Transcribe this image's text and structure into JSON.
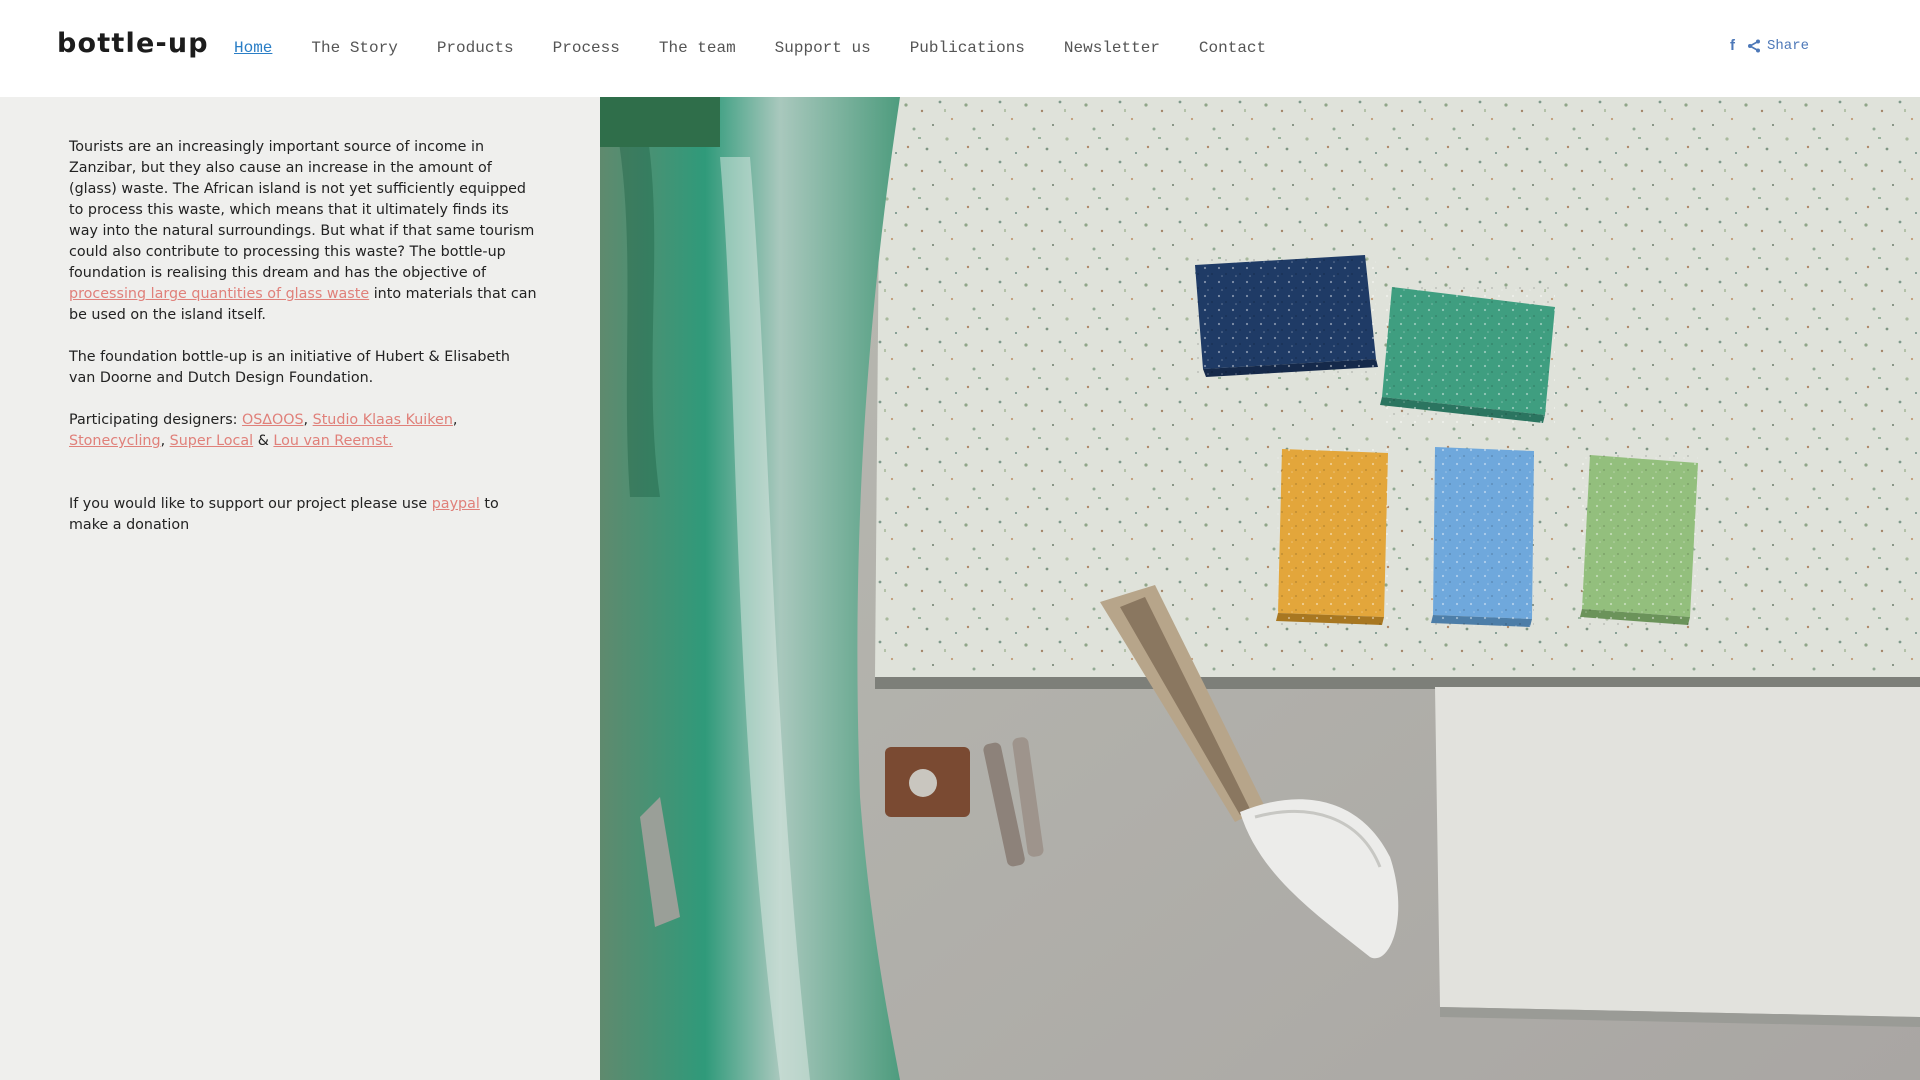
{
  "header": {
    "logo": "bottle-up",
    "nav": [
      {
        "label": "Home",
        "active": true
      },
      {
        "label": "The Story"
      },
      {
        "label": "Products"
      },
      {
        "label": "Process"
      },
      {
        "label": "The team"
      },
      {
        "label": "Support us"
      },
      {
        "label": "Publications"
      },
      {
        "label": "Newsletter"
      },
      {
        "label": "Contact"
      }
    ],
    "social": {
      "facebook_icon": "facebook-icon",
      "share_icon": "share-icon",
      "share_label": "Share"
    }
  },
  "content": {
    "intro_before_link": "Tourists are an increasingly important source of income in Zanzibar, but they also cause an increase in the amount of (glass) waste. The African island is not yet sufficiently equipped to process this waste, which means that it ultimately finds its way into the natural surroundings. But what if that same tourism could also contribute to processing this waste? The bottle-up foundation is realising this dream and has the objective of ",
    "intro_link": "processing large quantities of glass waste",
    "intro_after_link": " into materials that can be used on the island itself.",
    "foundation": "The foundation bottle-up is an initiative of Hubert & Elisabeth van Doorne and Dutch Design Foundation.",
    "designers_prefix": "Participating designers: ",
    "designers": [
      "OS∆OOS",
      "Studio Klaas Kuiken",
      "Stonecycling",
      "Super Local",
      "Lou van Reemst."
    ],
    "sep_comma": ", ",
    "sep_amp": " & ",
    "support_before_link": "If you would like to support our project please use ",
    "support_link": "paypal",
    "support_after_link": " to make a donation"
  },
  "colors": {
    "nav_active": "#2a7ec6",
    "link": "#e0807a",
    "panel_bg": "#efefed",
    "social": "#4d78b8"
  }
}
